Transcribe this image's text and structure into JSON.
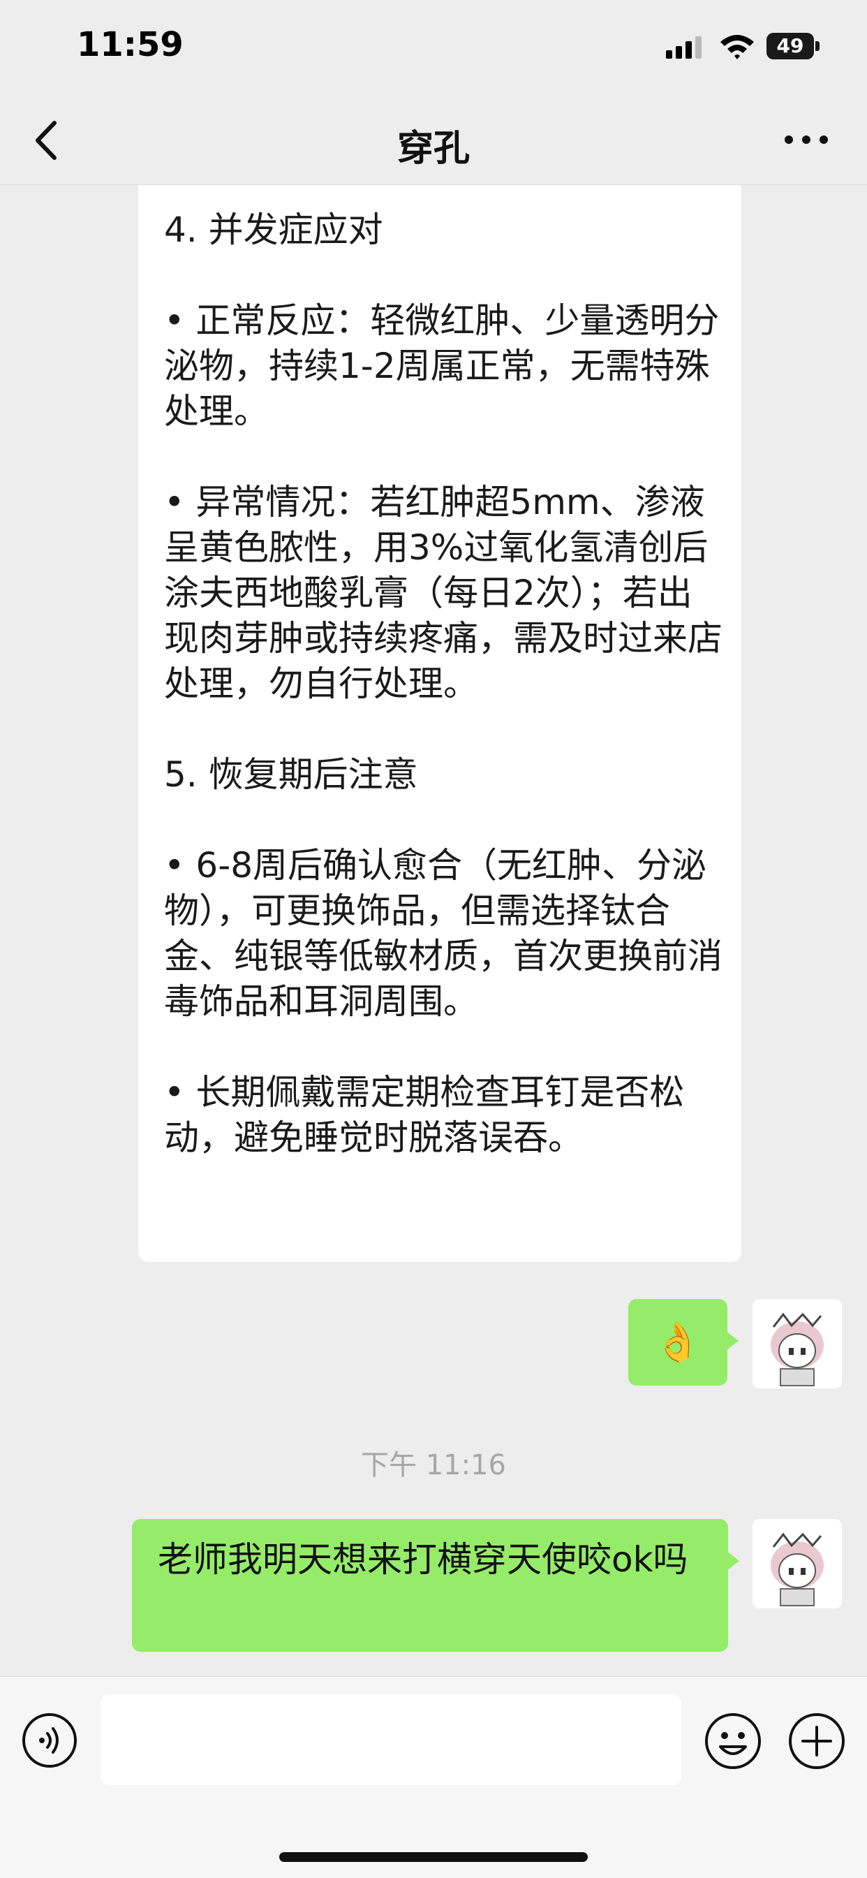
{
  "status_bar": {
    "time": "11:59",
    "battery": "49"
  },
  "nav": {
    "title": "穿孔"
  },
  "messages": {
    "care_text": "4. 并发症应对\n\n• 正常反应：轻微红肿、少量透明分泌物，持续1-2周属正常，无需特殊处理。\n\n• 异常情况：若红肿超5mm、渗液呈黄色脓性，用3%过氧化氢清创后涂夫西地酸乳膏（每日2次）；若出现肉芽肿或持续疼痛，需及时过来店处理，勿自行处理。\n\n5. 恢复期后注意\n\n• 6-8周后确认愈合（无红肿、分泌物），可更换饰品，但需选择钛合金、纯银等低敏材质，首次更换前消毒饰品和耳洞周围。\n\n• 长期佩戴需定期检查耳钉是否松动，避免睡觉时脱落误吞。",
    "ok_emoji": "👌",
    "time_separator": "下午 11:16",
    "user_text": "老师我明天想来打横穿天使咬ok吗"
  },
  "input": {
    "placeholder": ""
  },
  "colors": {
    "green_bubble": "#95ec69",
    "background": "#ededed"
  }
}
